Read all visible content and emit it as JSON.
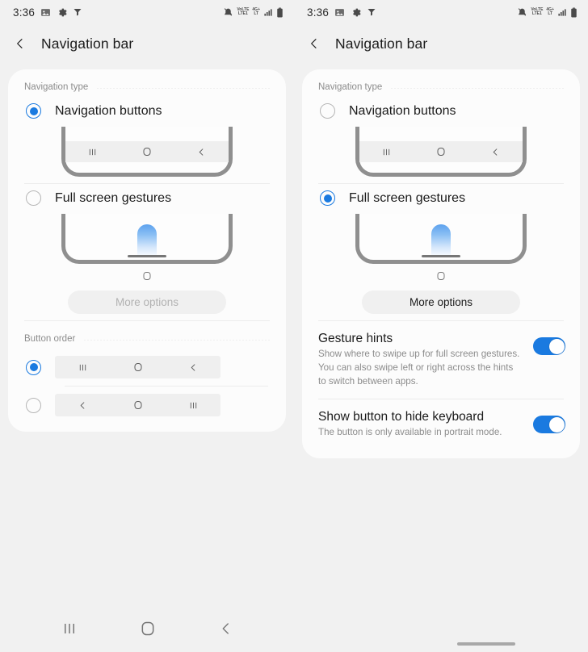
{
  "status_bar": {
    "time": "3:36",
    "left_icons": [
      "image-icon",
      "gear-icon",
      "filter-icon"
    ],
    "right_icons": [
      "mute-icon",
      "volte-icon",
      "network-4g-icon",
      "signal-icon",
      "battery-icon"
    ],
    "volte_top": "VoLTE",
    "volte_bottom": "LTE1",
    "network_top": "4G+",
    "network_bottom": "LT"
  },
  "app_bar": {
    "back_label": "back-chevron",
    "title": "Navigation bar"
  },
  "colors": {
    "accent": "#1a7ae0",
    "page_bg": "#f1f1f1",
    "card_bg": "#fcfcfc",
    "muted_text": "#8c8c8c",
    "primary_text": "#1b1b1b"
  },
  "left_pane": {
    "navigation_type": {
      "section_label": "Navigation type",
      "options": [
        {
          "label": "Navigation buttons",
          "selected": true
        },
        {
          "label": "Full screen gestures",
          "selected": false
        }
      ],
      "more_options_label": "More options",
      "more_options_enabled": false
    },
    "button_order": {
      "section_label": "Button order",
      "options": [
        {
          "glyphs": [
            "recents",
            "home",
            "back"
          ],
          "selected": true
        },
        {
          "glyphs": [
            "back",
            "home",
            "recents"
          ],
          "selected": false
        }
      ]
    }
  },
  "right_pane": {
    "navigation_type": {
      "section_label": "Navigation type",
      "options": [
        {
          "label": "Navigation buttons",
          "selected": false
        },
        {
          "label": "Full screen gestures",
          "selected": true
        }
      ],
      "more_options_label": "More options",
      "more_options_enabled": true
    },
    "settings": [
      {
        "title": "Gesture hints",
        "subtitle": "Show where to swipe up for full screen gestures. You can also swipe left or right across the hints to switch between apps.",
        "enabled": true
      },
      {
        "title": "Show button to hide keyboard",
        "subtitle": "The button is only available in portrait mode.",
        "enabled": true
      }
    ]
  },
  "system_nav": {
    "buttons": [
      "recents-icon",
      "home-icon",
      "back-icon"
    ],
    "handle": "gesture-handle"
  }
}
